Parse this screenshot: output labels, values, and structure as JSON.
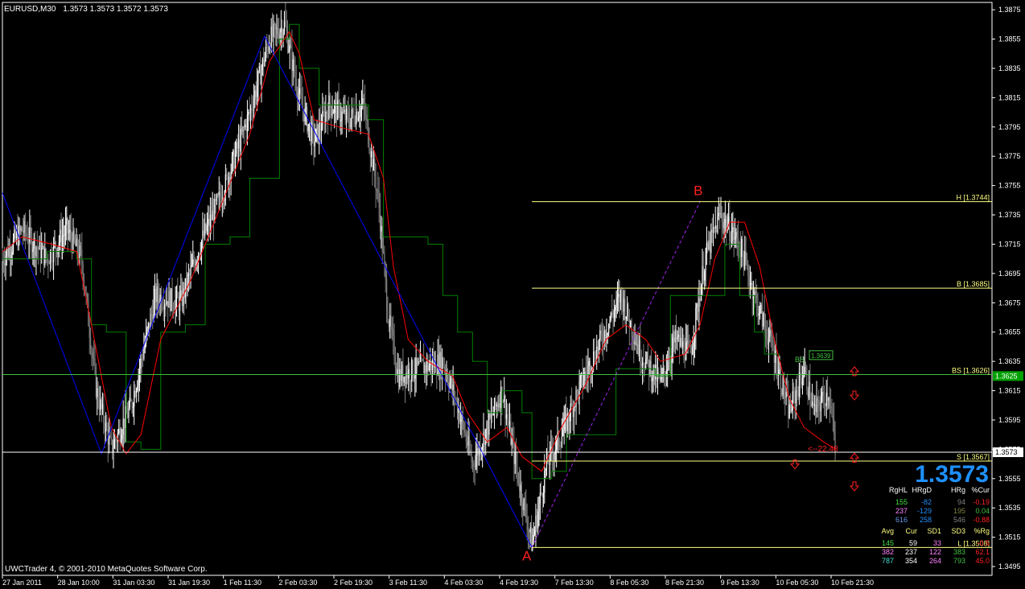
{
  "header": {
    "symbol": "EURUSD,M30",
    "quote": "1.3573 1.3573 1.3572 1.3573"
  },
  "footer": {
    "copyright": "UWCTrader 4, © 2001-2010 MetaQuotes Software Corp."
  },
  "colors": {
    "background": "#000000",
    "frame": "#ffffff",
    "candles_up": "#ffffff",
    "candles_down": "#808080",
    "ma_red": "#ff0000",
    "trailing_green": "#008000",
    "zigzag_blue": "#0000ff",
    "dash_purple": "#a020f0",
    "levels_yellow": "#ffff80",
    "bs_line": "#40c040",
    "price_line": "#ffffff",
    "current_big": "#1e90ff",
    "marker_red": "#ff2020"
  },
  "chart_data": {
    "type": "candlestick",
    "title": "EURUSD,M30",
    "y_ticks": [
      "1.3875",
      "1.3855",
      "1.3835",
      "1.3815",
      "1.3795",
      "1.3775",
      "1.3755",
      "1.3735",
      "1.3715",
      "1.3695",
      "1.3675",
      "1.3655",
      "1.3635",
      "1.3615",
      "1.3595",
      "1.3575",
      "1.3555",
      "1.3535",
      "1.3515",
      "1.3495"
    ],
    "ylim": [
      1.3489,
      1.388
    ],
    "x_ticks": [
      "27 Jan 2011",
      "28 Jan 10:00",
      "31 Jan 03:30",
      "31 Jan 19:30",
      "1 Feb 11:30",
      "2 Feb 03:30",
      "2 Feb 19:30",
      "3 Feb 11:30",
      "4 Feb 03:30",
      "4 Feb 19:30",
      "7 Feb 13:30",
      "8 Feb 05:30",
      "8 Feb 21:30",
      "9 Feb 13:30",
      "10 Feb 05:30",
      "10 Feb 21:30"
    ],
    "price_path": [
      [
        0,
        1.3705
      ],
      [
        0.02,
        1.3725
      ],
      [
        0.045,
        1.3705
      ],
      [
        0.065,
        1.3725
      ],
      [
        0.08,
        1.3705
      ],
      [
        0.095,
        1.3615
      ],
      [
        0.11,
        1.3575
      ],
      [
        0.13,
        1.3605
      ],
      [
        0.155,
        1.368
      ],
      [
        0.18,
        1.3675
      ],
      [
        0.2,
        1.3715
      ],
      [
        0.225,
        1.3755
      ],
      [
        0.25,
        1.3805
      ],
      [
        0.27,
        1.3855
      ],
      [
        0.285,
        1.3865
      ],
      [
        0.3,
        1.3815
      ],
      [
        0.315,
        1.3785
      ],
      [
        0.33,
        1.381
      ],
      [
        0.35,
        1.38
      ],
      [
        0.365,
        1.381
      ],
      [
        0.38,
        1.3745
      ],
      [
        0.39,
        1.3665
      ],
      [
        0.4,
        1.3625
      ],
      [
        0.42,
        1.363
      ],
      [
        0.445,
        1.3635
      ],
      [
        0.46,
        1.3605
      ],
      [
        0.475,
        1.3565
      ],
      [
        0.49,
        1.359
      ],
      [
        0.505,
        1.3615
      ],
      [
        0.52,
        1.356
      ],
      [
        0.535,
        1.351
      ],
      [
        0.55,
        1.3565
      ],
      [
        0.565,
        1.3585
      ],
      [
        0.585,
        1.362
      ],
      [
        0.605,
        1.365
      ],
      [
        0.625,
        1.368
      ],
      [
        0.645,
        1.364
      ],
      [
        0.665,
        1.362
      ],
      [
        0.68,
        1.365
      ],
      [
        0.695,
        1.364
      ],
      [
        0.71,
        1.3705
      ],
      [
        0.725,
        1.3735
      ],
      [
        0.745,
        1.3715
      ],
      [
        0.76,
        1.368
      ],
      [
        0.78,
        1.364
      ],
      [
        0.795,
        1.36
      ],
      [
        0.81,
        1.363
      ],
      [
        0.82,
        1.36
      ],
      [
        0.835,
        1.3615
      ],
      [
        0.842,
        1.3573
      ]
    ],
    "ma_red": [
      [
        0,
        1.371
      ],
      [
        0.02,
        1.372
      ],
      [
        0.05,
        1.3715
      ],
      [
        0.075,
        1.371
      ],
      [
        0.09,
        1.366
      ],
      [
        0.11,
        1.359
      ],
      [
        0.125,
        1.3572
      ],
      [
        0.14,
        1.3585
      ],
      [
        0.16,
        1.365
      ],
      [
        0.19,
        1.369
      ],
      [
        0.22,
        1.374
      ],
      [
        0.25,
        1.379
      ],
      [
        0.27,
        1.384
      ],
      [
        0.29,
        1.386
      ],
      [
        0.3,
        1.3845
      ],
      [
        0.315,
        1.38
      ],
      [
        0.34,
        1.3795
      ],
      [
        0.37,
        1.379
      ],
      [
        0.385,
        1.376
      ],
      [
        0.395,
        1.37
      ],
      [
        0.41,
        1.365
      ],
      [
        0.43,
        1.3635
      ],
      [
        0.455,
        1.3625
      ],
      [
        0.47,
        1.36
      ],
      [
        0.49,
        1.358
      ],
      [
        0.51,
        1.359
      ],
      [
        0.525,
        1.357
      ],
      [
        0.545,
        1.356
      ],
      [
        0.565,
        1.359
      ],
      [
        0.59,
        1.362
      ],
      [
        0.61,
        1.365
      ],
      [
        0.63,
        1.366
      ],
      [
        0.65,
        1.365
      ],
      [
        0.665,
        1.3635
      ],
      [
        0.69,
        1.364
      ],
      [
        0.705,
        1.366
      ],
      [
        0.72,
        1.3705
      ],
      [
        0.735,
        1.373
      ],
      [
        0.75,
        1.373
      ],
      [
        0.765,
        1.37
      ],
      [
        0.78,
        1.365
      ],
      [
        0.795,
        1.361
      ],
      [
        0.81,
        1.359
      ],
      [
        0.83,
        1.358
      ],
      [
        0.842,
        1.3575
      ]
    ],
    "trailing_green": [
      [
        0,
        1.3705
      ],
      [
        0.045,
        1.371
      ],
      [
        0.075,
        1.3705
      ],
      [
        0.09,
        1.366
      ],
      [
        0.105,
        1.3655
      ],
      [
        0.125,
        1.358
      ],
      [
        0.14,
        1.3575
      ],
      [
        0.16,
        1.3655
      ],
      [
        0.185,
        1.366
      ],
      [
        0.205,
        1.3715
      ],
      [
        0.23,
        1.372
      ],
      [
        0.25,
        1.376
      ],
      [
        0.28,
        1.3855
      ],
      [
        0.29,
        1.3865
      ],
      [
        0.3,
        1.3835
      ],
      [
        0.32,
        1.381
      ],
      [
        0.36,
        1.381
      ],
      [
        0.37,
        1.38
      ],
      [
        0.385,
        1.372
      ],
      [
        0.43,
        1.3715
      ],
      [
        0.445,
        1.368
      ],
      [
        0.46,
        1.3655
      ],
      [
        0.475,
        1.3635
      ],
      [
        0.49,
        1.36
      ],
      [
        0.505,
        1.3615
      ],
      [
        0.525,
        1.36
      ],
      [
        0.535,
        1.3555
      ],
      [
        0.555,
        1.356
      ],
      [
        0.57,
        1.3585
      ],
      [
        0.59,
        1.3585
      ],
      [
        0.62,
        1.363
      ],
      [
        0.66,
        1.3625
      ],
      [
        0.675,
        1.368
      ],
      [
        0.72,
        1.368
      ],
      [
        0.73,
        1.3715
      ],
      [
        0.745,
        1.368
      ],
      [
        0.76,
        1.3655
      ],
      [
        0.77,
        1.364
      ],
      [
        0.785,
        1.3639
      ]
    ],
    "zigzag": [
      [
        0,
        1.375
      ],
      [
        0.1,
        1.3572
      ],
      [
        0.265,
        1.3857
      ],
      [
        0.535,
        1.3508
      ]
    ],
    "dashed_ab": [
      [
        0.535,
        1.3508
      ],
      [
        0.705,
        1.3744
      ]
    ],
    "levels": [
      {
        "label": "H [1.3744]",
        "value": 1.3744,
        "x_start": 0.535
      },
      {
        "label": "B [1.3685]",
        "value": 1.3685,
        "x_start": 0.535
      },
      {
        "label": "BS [1.3626]",
        "value": 1.3626,
        "x_start": 0.0
      },
      {
        "label": "S [1.3567]",
        "value": 1.3567,
        "x_start": 0.535
      },
      {
        "label": "L [1.3508]",
        "value": 1.3508,
        "x_start": 0.535
      }
    ],
    "price_line": 1.3573,
    "bs_axis_label": "1.3625",
    "current_price_label": "1.3573",
    "points": [
      {
        "label": "B",
        "value": 1.3744,
        "x": 0.705
      },
      {
        "label": "A",
        "value": 1.3508,
        "x": 0.535
      }
    ],
    "bs_box_label": "1.3639",
    "bs_text": "BS",
    "annotation": "<--22.48",
    "stats": {
      "row1_headers": [
        "RgHL",
        "HRgD",
        "HRg",
        "%Cur"
      ],
      "row1": [
        [
          "155",
          "-82",
          "94",
          "-0.19"
        ],
        [
          "237",
          "-129",
          "195",
          "0.04"
        ],
        [
          "616",
          "258",
          "546",
          "-0.88"
        ]
      ],
      "row2_headers": [
        "Avg",
        "Cur",
        "SD1",
        "SD3",
        "%Rg"
      ],
      "row2": [
        [
          "145",
          "59",
          "33",
          "",
          "-0.5"
        ],
        [
          "382",
          "237",
          "122",
          "383",
          "62.1"
        ],
        [
          "787",
          "354",
          "264",
          "793",
          "45.0"
        ]
      ]
    }
  }
}
